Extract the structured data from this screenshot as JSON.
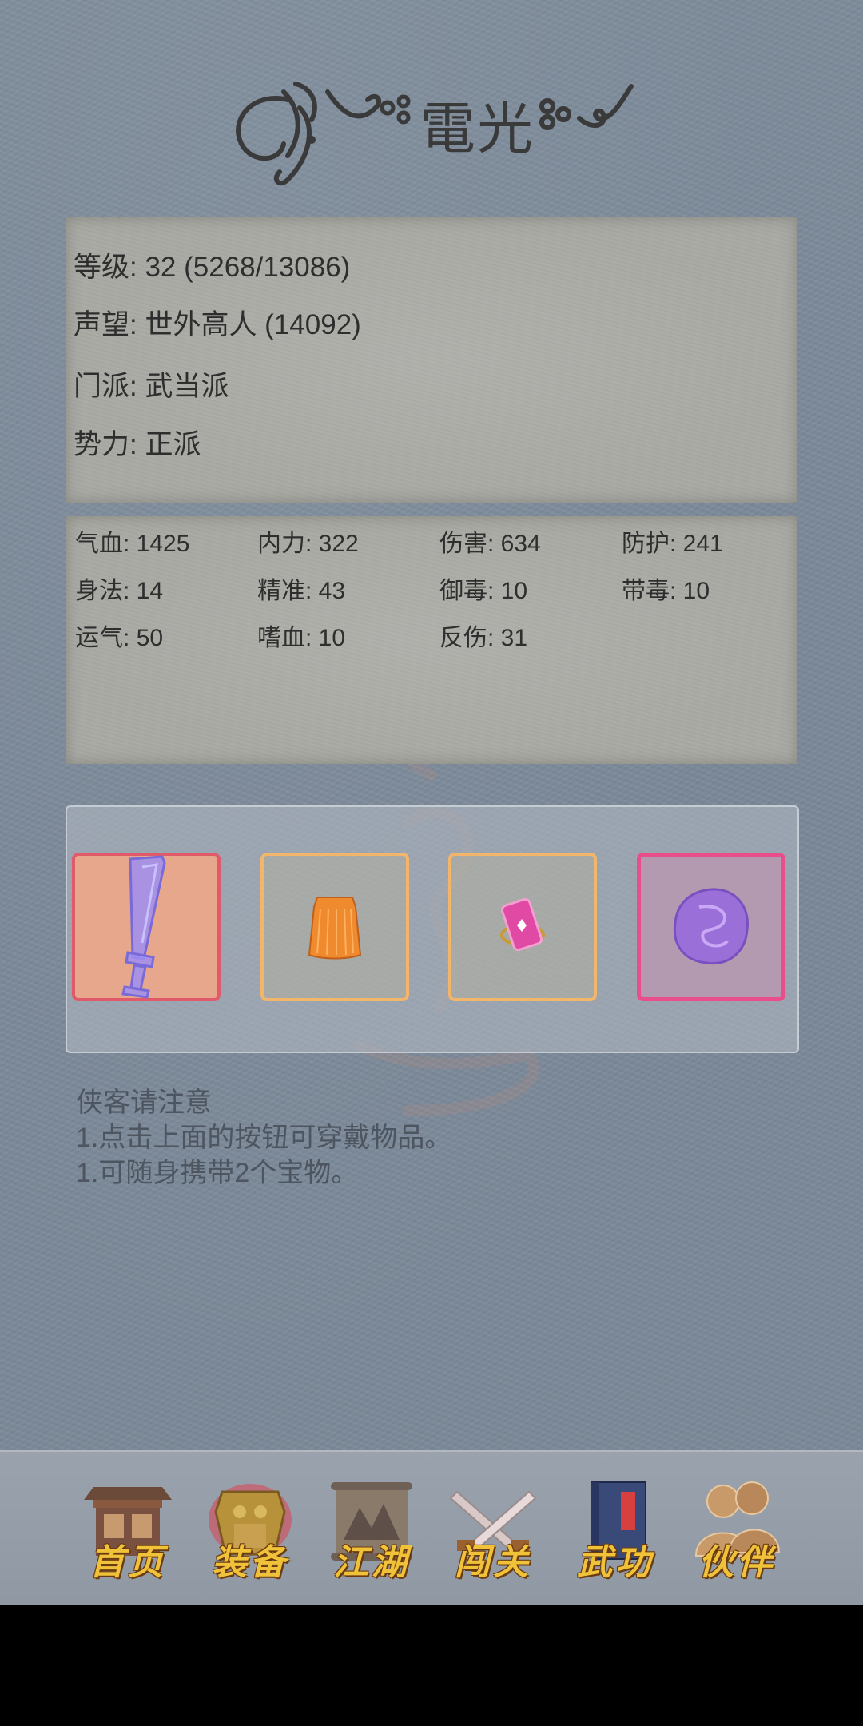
{
  "title": "電光",
  "info": {
    "level": "等级: 32 (5268/13086)",
    "prestige": "声望: 世外高人 (14092)",
    "sect": "门派: 武当派",
    "faction": "势力: 正派"
  },
  "stats": [
    "气血: 1425",
    "内力: 322",
    "伤害: 634",
    "防护: 241",
    "身法: 14",
    "精准: 43",
    "御毒: 10",
    "带毒: 10",
    "运气: 50",
    "嗜血: 10",
    "反伤: 31"
  ],
  "equipment": [
    {
      "icon": "sword-icon"
    },
    {
      "icon": "armor-skirt-icon"
    },
    {
      "icon": "talisman-icon"
    },
    {
      "icon": "purple-orb-icon"
    }
  ],
  "notice": {
    "heading": "侠客请注意",
    "line1": "1.点击上面的按钮可穿戴物品。",
    "line2": "1.可随身携带2个宝物。"
  },
  "nav": [
    {
      "label": "首页",
      "icon": "pavilion-icon"
    },
    {
      "label": "装备",
      "icon": "armor-icon"
    },
    {
      "label": "江湖",
      "icon": "scroll-map-icon"
    },
    {
      "label": "闯关",
      "icon": "crossed-swords-icon"
    },
    {
      "label": "武功",
      "icon": "book-icon"
    },
    {
      "label": "伙伴",
      "icon": "companions-icon"
    }
  ],
  "colors": {
    "background": "#7b8998",
    "paper": "#a9a9a4",
    "nav_text": "#f0c23a",
    "slot_red": "#e05a6a",
    "slot_orange": "#f2b56a",
    "slot_pink": "#e94d8a"
  }
}
